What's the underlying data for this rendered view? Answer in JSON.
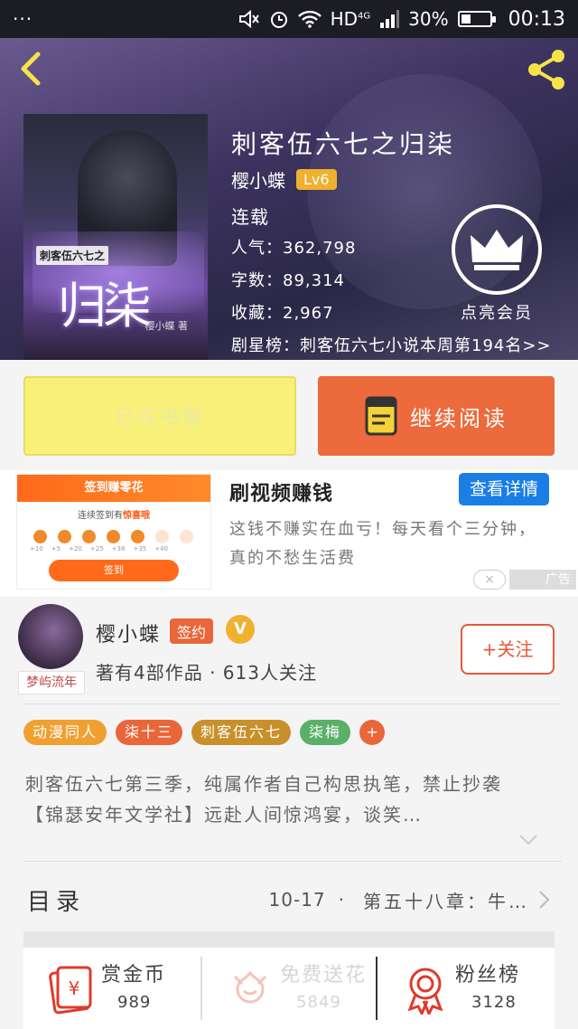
{
  "status_bar": {
    "menu": "···",
    "network": "HD",
    "signal_type": "4G",
    "battery": "30%",
    "time": "00:13"
  },
  "book": {
    "title": "刺客伍六七之归柒",
    "author": "樱小蝶",
    "level": "Lv6",
    "status": "连载",
    "popularity": "人气：362,798",
    "word_count": "字数：89,314",
    "favorites": "收藏：2,967",
    "ranking": "剧星榜：刺客伍六七小说本周第194名>>",
    "cover_subtitle": "刺客伍六七之",
    "cover_title": "归柒",
    "cover_author": "樱小蝶 著"
  },
  "vip": {
    "label": "点亮会员"
  },
  "actions": {
    "shelf": "已在书架",
    "read": "继续阅读"
  },
  "ad": {
    "thumb_title": "签到赚零花",
    "thumb_sub_prefix": "连续签到有",
    "thumb_sub_bold": "惊喜哦",
    "thumb_nums": [
      "+10",
      "+5",
      "+20",
      "+25",
      "+38",
      "+35",
      "+40"
    ],
    "thumb_button": "签到",
    "title": "刷视频赚钱",
    "detail_button": "查看详情",
    "description": "这钱不赚实在血亏！每天看个三分钟，真的不愁生活费",
    "close": "×",
    "tag": "广告"
  },
  "author_card": {
    "name": "樱小蝶",
    "sign_badge": "签约",
    "v_badge": "V",
    "works": "著有4部作品 · 613人关注",
    "follow": "+关注",
    "avatar_tag": "梦屿流年"
  },
  "tags": [
    {
      "label": "动漫同人",
      "color": "#f0a030"
    },
    {
      "label": "柒十三",
      "color": "#e8663a"
    },
    {
      "label": "刺客伍六七",
      "color": "#c8902a"
    },
    {
      "label": "柒梅",
      "color": "#5ab068"
    }
  ],
  "tag_add": "+",
  "intro": "刺客伍六七第三季，纯属作者自己构思执笔，禁止抄袭　　【锦瑟安年文学社】远赴人间惊鸿宴，谈笑…",
  "toc": {
    "label": "目录",
    "date": "10-17",
    "separator": "·",
    "latest": "第五十八章：牛…"
  },
  "bottom": {
    "reward": {
      "label": "赏金币",
      "count": "989"
    },
    "flower": {
      "label": "免费送花",
      "count": "5849"
    },
    "fans": {
      "label": "粉丝榜",
      "count": "3128"
    }
  },
  "colors": {
    "accent": "#ec6a3c",
    "shelf": "#f9f07a",
    "ad_blue": "#1a7ee6"
  }
}
